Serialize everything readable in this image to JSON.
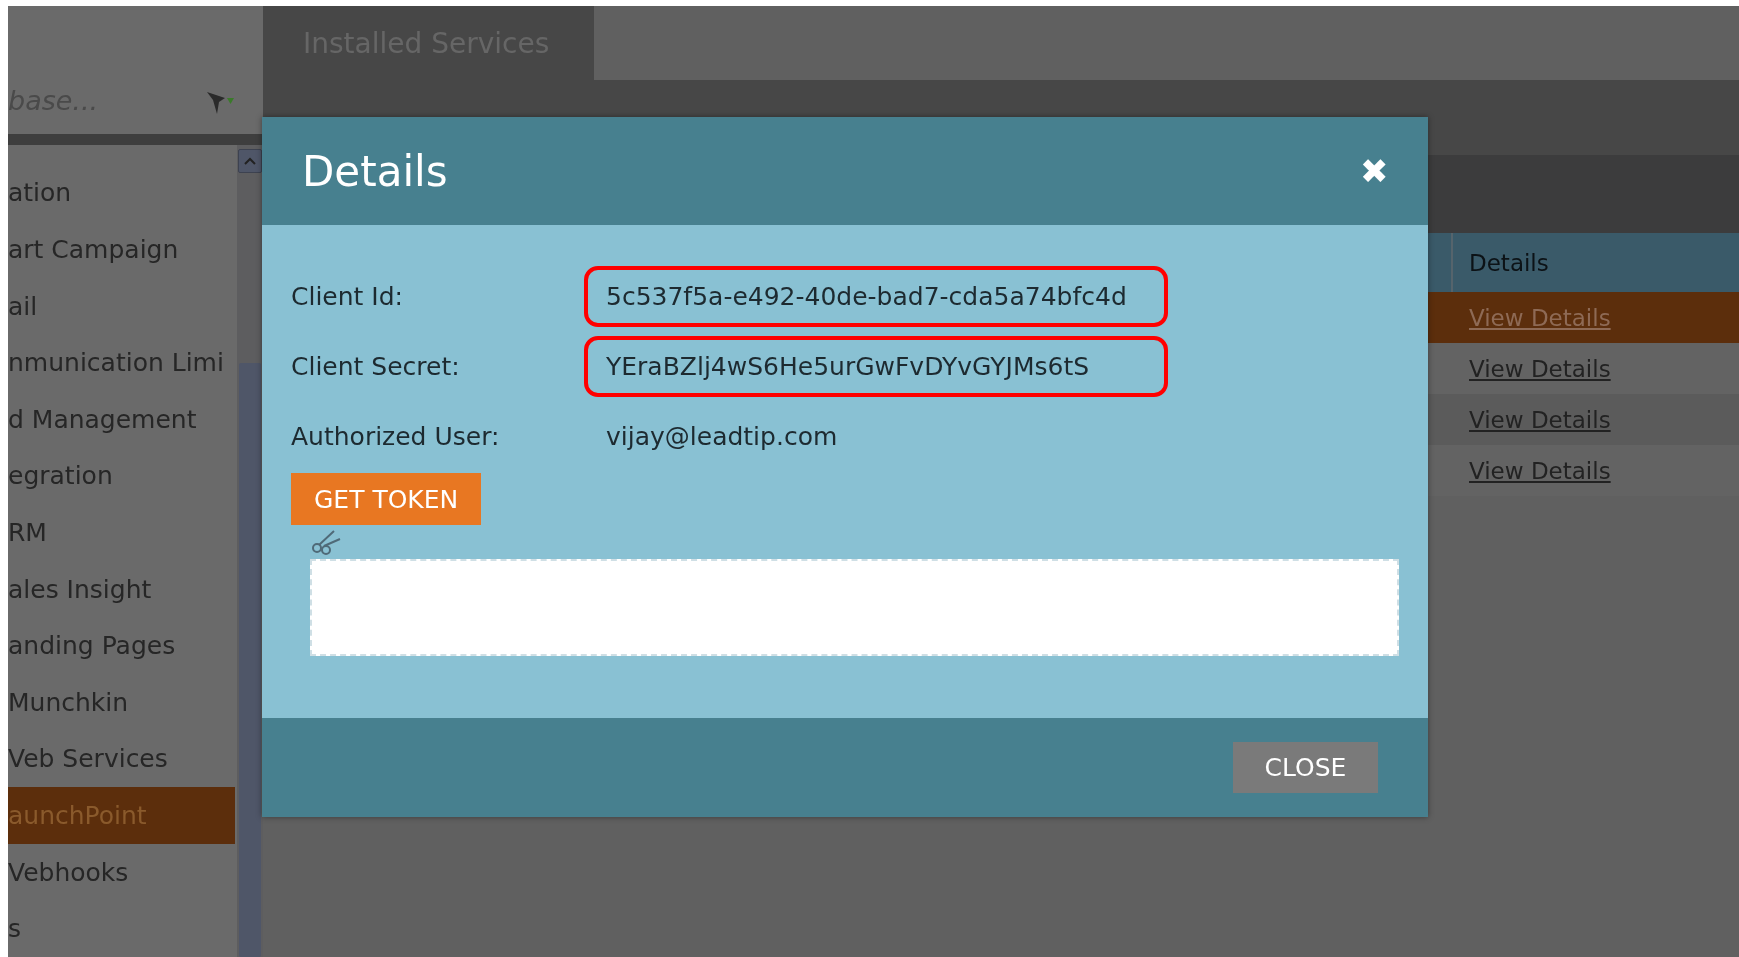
{
  "sidebar": {
    "search": {
      "placeholder": "base..."
    },
    "items": [
      {
        "label": "ation",
        "selected": false
      },
      {
        "label": "art Campaign",
        "selected": false
      },
      {
        "label": "ail",
        "selected": false
      },
      {
        "label": "nmunication Limi",
        "selected": false
      },
      {
        "label": "d Management",
        "selected": false
      },
      {
        "label": "egration",
        "selected": false
      },
      {
        "label": "RM",
        "selected": false
      },
      {
        "label": "ales Insight",
        "selected": false
      },
      {
        "label": "anding Pages",
        "selected": false
      },
      {
        "label": "Munchkin",
        "selected": false
      },
      {
        "label": "Veb Services",
        "selected": false
      },
      {
        "label": "aunchPoint",
        "selected": true
      },
      {
        "label": "Vebhooks",
        "selected": false
      },
      {
        "label": "s",
        "selected": false
      }
    ]
  },
  "tabs": [
    {
      "label": "Installed Services",
      "selected": true
    }
  ],
  "table": {
    "columns": [
      "Details"
    ],
    "rows": [
      {
        "details": "View Details",
        "selected": true
      },
      {
        "details": "View Details",
        "selected": false
      },
      {
        "details": "View Details",
        "selected": false
      },
      {
        "details": "View Details",
        "selected": false
      }
    ]
  },
  "dialog": {
    "title": "Details",
    "close_icon": "✖",
    "fields": [
      {
        "label": "Client Id:",
        "value": "5c537f5a-e492-40de-bad7-cda5a74bfc4d",
        "highlighted": true
      },
      {
        "label": "Client Secret:",
        "value": "YEraBZlj4wS6He5urGwFvDYvGYJMs6tS",
        "highlighted": true
      },
      {
        "label": "Authorized User:",
        "value": "vijay@leadtip.com",
        "highlighted": false
      }
    ],
    "token_button": "GET TOKEN",
    "close_button": "CLOSE"
  }
}
